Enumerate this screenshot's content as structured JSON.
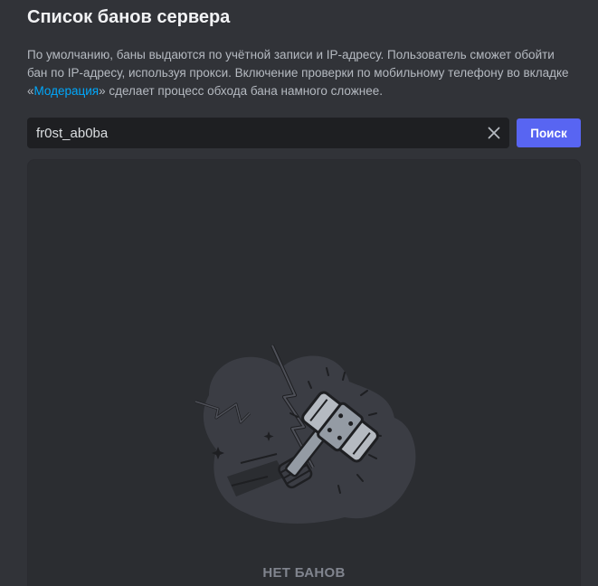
{
  "header": {
    "title": "Список банов сервера"
  },
  "description": {
    "text_before": "По умолчанию, баны выдаются по учётной записи и IP-адресу. Пользователь сможет обойти бан по IP-адресу, используя прокси. Включение проверки по мобильному телефону во вкладке «",
    "link": "Модерация",
    "text_after": "» сделает процесс обхода бана намного сложнее."
  },
  "search": {
    "value": "fr0st_ab0ba",
    "button_label": "Поиск",
    "clear_icon": "close-icon"
  },
  "bans": {
    "empty_label": "НЕТ БАНОВ",
    "illustration": "ban-hammer-illustration"
  },
  "colors": {
    "background": "#313338",
    "panel": "#2b2d31",
    "input": "#1e1f22",
    "accent": "#5865f2",
    "link": "#00a8fc"
  }
}
